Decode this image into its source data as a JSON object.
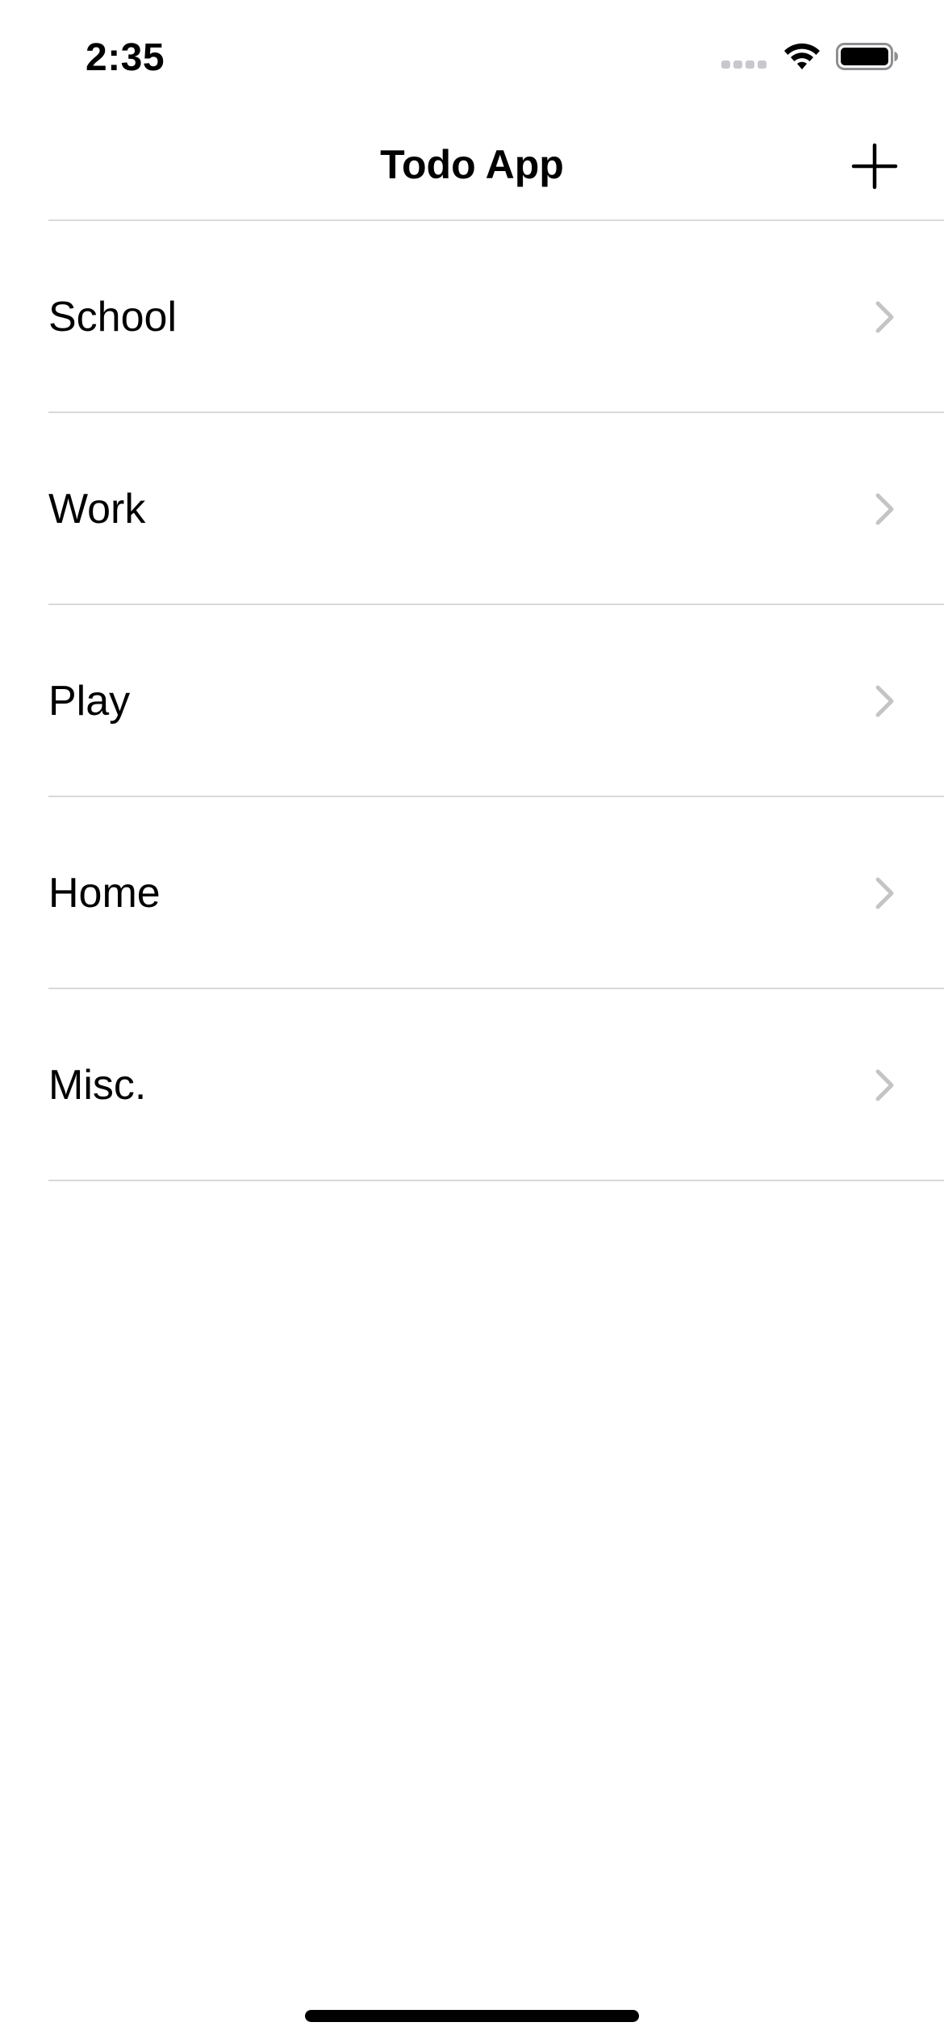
{
  "status_bar": {
    "time": "2:35"
  },
  "nav": {
    "title": "Todo App",
    "add_icon": "plus-icon"
  },
  "list": {
    "items": [
      {
        "label": "School"
      },
      {
        "label": "Work"
      },
      {
        "label": "Play"
      },
      {
        "label": "Home"
      },
      {
        "label": "Misc."
      }
    ],
    "accessory_icon": "chevron-right-icon"
  },
  "colors": {
    "background": "#ffffff",
    "text": "#000000",
    "separator": "#d9d9dc",
    "chevron": "#c4c4c7",
    "signal_inactive": "#c7c7cc"
  }
}
